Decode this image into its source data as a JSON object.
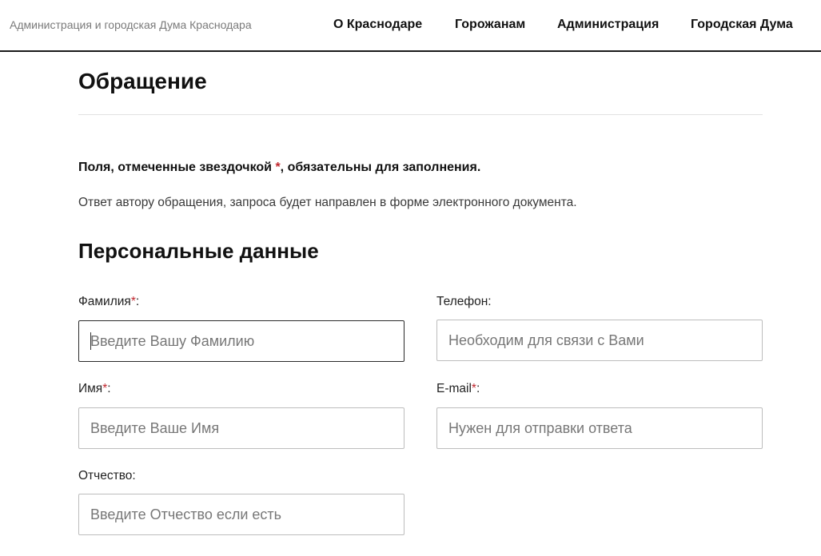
{
  "header": {
    "site_name": "Администрация и городская Дума Краснодара",
    "nav": [
      {
        "label": "О Краснодаре"
      },
      {
        "label": "Горожанам"
      },
      {
        "label": "Администрация"
      },
      {
        "label": "Городская Дума"
      }
    ]
  },
  "main": {
    "title": "Обращение",
    "required_note_before": "Поля, отмеченные звездочкой ",
    "required_star": "*",
    "required_note_after": ", обязательны для заполнения.",
    "info_note": "Ответ автору обращения, запроса будет направлен в форме электронного документа.",
    "section_title": "Персональные данные"
  },
  "form": {
    "surname": {
      "label": "Фамилия",
      "star": "*",
      "colon": ":",
      "value": "",
      "placeholder": "Введите Вашу Фамилию"
    },
    "phone": {
      "label": "Телефон:",
      "value": "",
      "placeholder": "Необходим для связи с Вами"
    },
    "name": {
      "label": "Имя",
      "star": "*",
      "colon": ":",
      "value": "",
      "placeholder": "Введите Ваше Имя"
    },
    "email": {
      "label": "E-mail",
      "star": "*",
      "colon": ":",
      "value": "",
      "placeholder": "Нужен для отправки ответа"
    },
    "patronymic": {
      "label": "Отчество:",
      "value": "",
      "placeholder": "Введите Отчество если есть"
    }
  },
  "colors": {
    "accent_required": "#c0262d",
    "header_border": "#1a1a1a",
    "text_primary": "#111111",
    "site_name": "#7a7a7a"
  }
}
